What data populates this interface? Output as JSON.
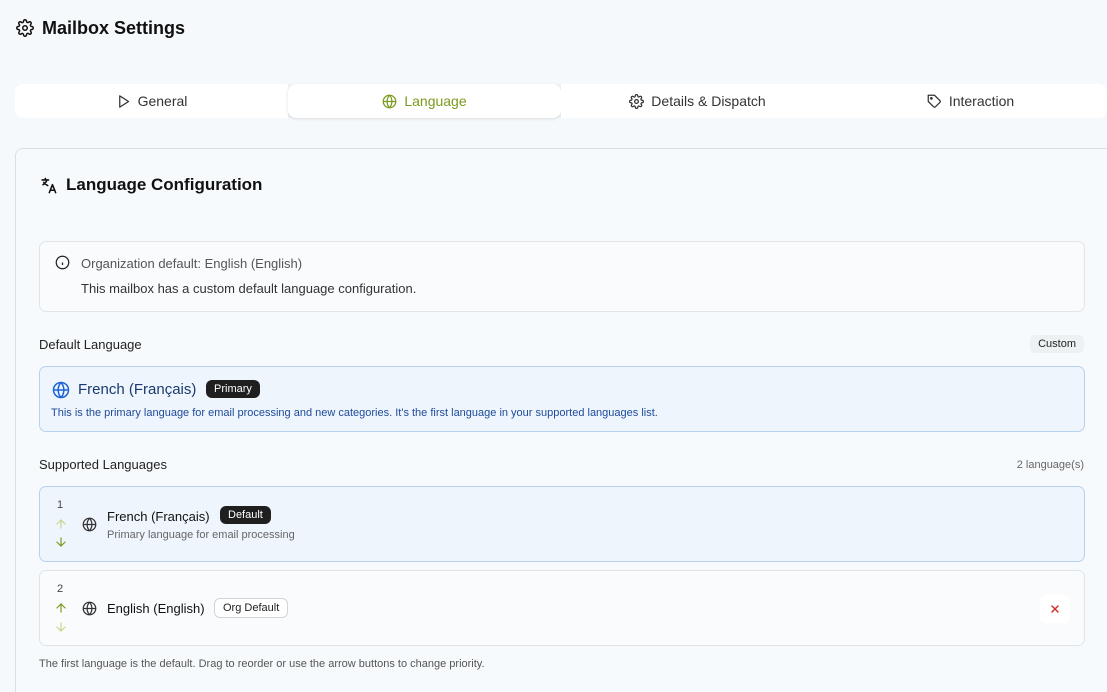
{
  "header": {
    "title": "Mailbox Settings",
    "icon": "gear-icon"
  },
  "tabs": [
    {
      "label": "General",
      "icon": "play-icon",
      "active": false
    },
    {
      "label": "Language",
      "icon": "globe-icon",
      "active": true
    },
    {
      "label": "Details & Dispatch",
      "icon": "gear-icon",
      "active": false
    },
    {
      "label": "Interaction",
      "icon": "tag-icon",
      "active": false
    }
  ],
  "card": {
    "title": "Language Configuration",
    "icon": "translate-icon",
    "info": {
      "line1": "Organization default: English (English)",
      "line2": "This mailbox has a custom default language configuration."
    },
    "default_section": {
      "label": "Default Language",
      "badge": "Custom",
      "language": "French (Français)",
      "primary_badge": "Primary",
      "description": "This is the primary language for email processing and new categories. It's the first language in your supported languages list."
    },
    "supported_section": {
      "label": "Supported Languages",
      "count": "2 language(s)",
      "items": [
        {
          "number": "1",
          "name": "French (Français)",
          "badge": "Default",
          "subtitle": "Primary language for email processing"
        },
        {
          "number": "2",
          "name": "English (English)",
          "badge": "Org Default",
          "subtitle": ""
        }
      ]
    },
    "footer": "The first language is the default. Drag to reorder or use the arrow buttons to change priority."
  },
  "colors": {
    "accent": "#7a9a1c",
    "primary_blue": "#1e4a9a",
    "remove_red": "#d32f2f"
  }
}
